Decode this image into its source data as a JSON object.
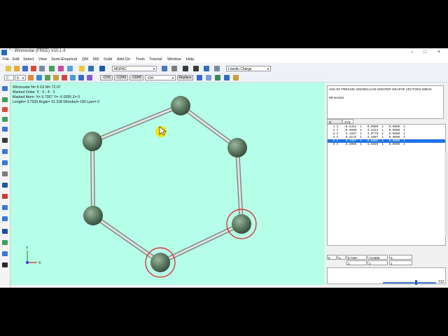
{
  "window": {
    "title": "* - Winmostar (FREE) V10.1.4",
    "controls": {
      "minimize": "–",
      "maximize": "□",
      "close": "×"
    }
  },
  "menu": [
    "File",
    "Edit",
    "Select",
    "View",
    "Semi-Empirical",
    "QM",
    "MD",
    "Solid",
    "Add-On",
    "Tools",
    "Tutorial",
    "Window",
    "Help"
  ],
  "toolbar": {
    "program_select": "MOPAC",
    "charge_select": "Löwdin Charge",
    "element_select": "C",
    "element_num": "6",
    "group_buttons": [
      "-CH3",
      "-C2H3",
      "-C6H5"
    ],
    "substituent_select": "-OH",
    "replace_label": "Replace"
  },
  "viewport": {
    "info": [
      "Winmostar  N= 6  C6  M= 72.07",
      "Marked Order: 5 - 6 - 4 - 3",
      "Marked Atom: X= 5.7267 Y= -0.0355 Z= 0",
      "Length= 3.7935 Angle= 31.228 Dihedral= 180 Lper= 0"
    ],
    "axis_labels": {
      "x": "X",
      "y": "Y"
    },
    "colors": {
      "background": "#b6ffe9",
      "atom": "#5c7a62",
      "bond": "#b4bcb6",
      "marker": "#e0191f",
      "cursor": "#f5e300"
    }
  },
  "command": {
    "line1": "AM1 EF PRECISE GNORM=0.05 NOINTER GRAPHF VECTORS MMOK",
    "line2": "Winmostar"
  },
  "tabs": [
    "Z-Matrix",
    "XYZ"
  ],
  "table_rows": [
    "   1 C   -6.5441  1   0.0000  1   0.0000  1",
    "   2 C   -0.5508  1   3.4412  1   0.0000  1",
    "   3 C    3.1937  1   4.9779  1   0.0000  1",
    "   4 C    5.5172  1   3.1007  1   0.0000  1",
    "   5 C    5.7267  1  -0.0355  1   0.0000  1",
    "   6 C    2.2005  1  -1.6586  1   0.0000  1"
  ],
  "selected_row": 4,
  "edit": {
    "row1": [
      "5",
      "C",
      "5.7267",
      "-0.0355",
      "0"
    ],
    "row2": [
      "1",
      "1",
      "1"
    ]
  },
  "zoom": {
    "value": "212",
    "fraction": 0.6
  }
}
